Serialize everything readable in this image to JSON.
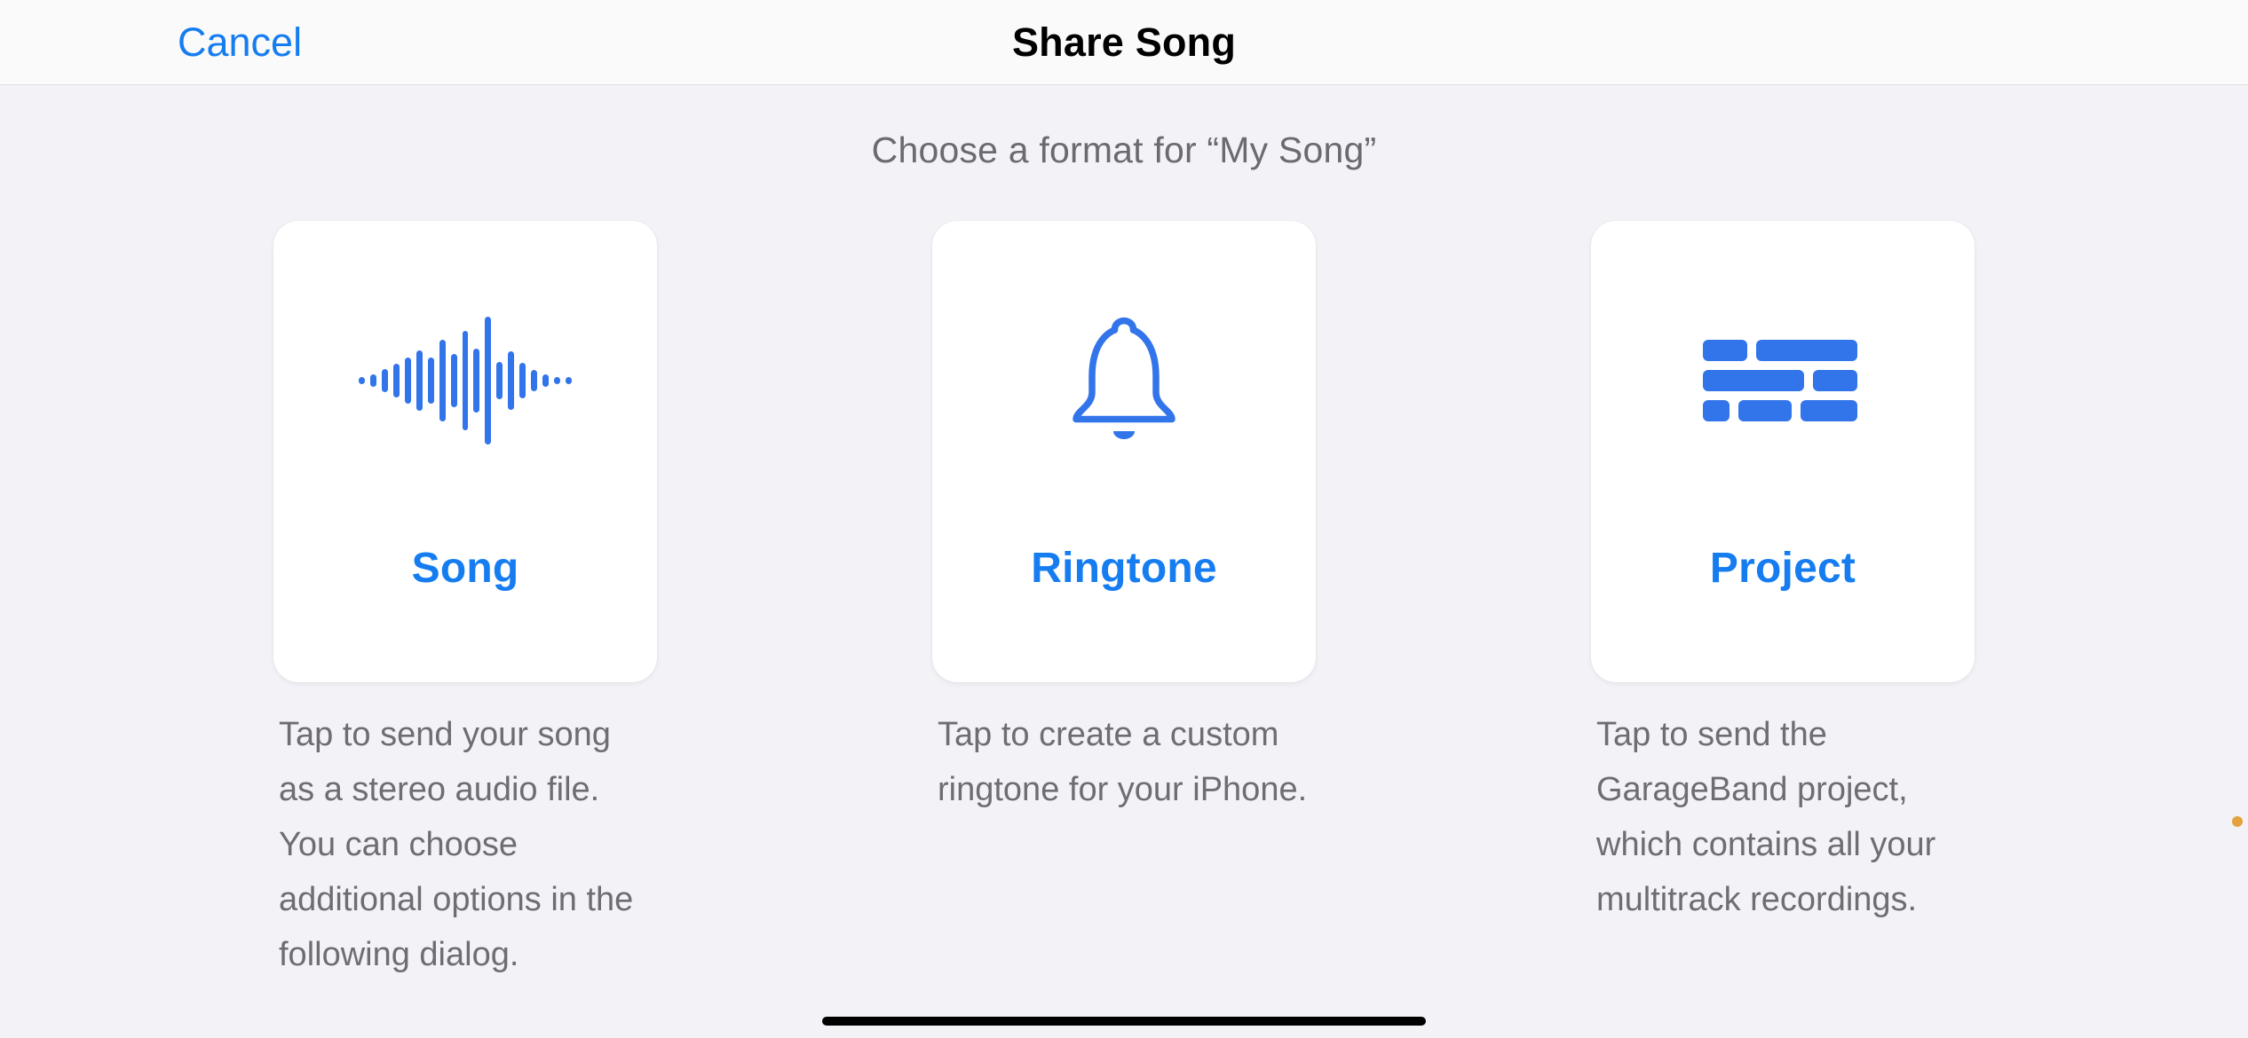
{
  "nav": {
    "cancel": "Cancel",
    "title": "Share Song"
  },
  "prompt": "Choose a format for “My Song”",
  "options": [
    {
      "icon": "waveform-icon",
      "title": "Song",
      "description": "Tap to send your song as a stereo audio file. You can choose additional options in the following dialog."
    },
    {
      "icon": "bell-icon",
      "title": "Ringtone",
      "description": "Tap to create a custom ringtone for your iPhone."
    },
    {
      "icon": "tracks-icon",
      "title": "Project",
      "description": "Tap to send the GarageBand project, which contains all your multitrack recordings."
    }
  ],
  "colors": {
    "accent": "#167df1",
    "icon": "#3274ea",
    "secondaryText": "#6d6d72"
  }
}
